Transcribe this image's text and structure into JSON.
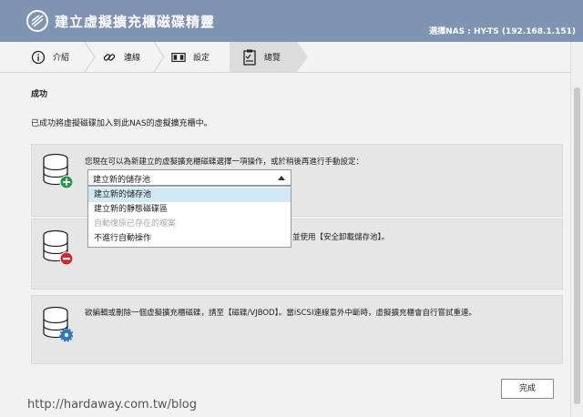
{
  "window": {
    "title": "建立虛擬擴充櫃磁碟精靈",
    "nas_label": "選擇NAS : HY-TS (192.168.1.151)"
  },
  "steps": [
    {
      "label": "介紹",
      "icon": "info-icon"
    },
    {
      "label": "連線",
      "icon": "link-icon"
    },
    {
      "label": "設定",
      "icon": "settings-panel-icon"
    },
    {
      "label": "總覽",
      "icon": "checklist-icon"
    }
  ],
  "main": {
    "heading": "成功",
    "message": "已成功將虛擬磁碟加入到此NAS的虛擬擴充櫃中。"
  },
  "panel_add": {
    "instruction": "您現在可以為新建立的虛擬擴充櫃磁碟選擇一項操作，或於稍後再進行手動設定：",
    "select_value": "建立新的儲存池",
    "options": [
      "建立新的儲存池",
      "建立新的靜態磁碟區",
      "自動復原已存在的檔案",
      "不進行自動操作"
    ],
    "icon": "disk-add-icon"
  },
  "panel_remove": {
    "text_visible": "並使用【安全卸載儲存池】。",
    "icon": "disk-remove-icon"
  },
  "panel_settings": {
    "text": "欲編輯或刪除一個虛擬擴充櫃磁碟，請至【磁碟/VJBOD】。當iSCSI連線意外中斷時，虛擬擴充櫃會自行嘗試重連。",
    "icon": "disk-settings-icon"
  },
  "footer": {
    "finish_label": "完成"
  },
  "watermark": "http://hardaway.com.tw/blog",
  "colors": {
    "titlebar": "#7f93b3",
    "add_badge": "#1e9b3c",
    "remove_badge": "#d9262b",
    "settings_badge": "#2a78c8",
    "highlight": "#cfe9f5"
  }
}
